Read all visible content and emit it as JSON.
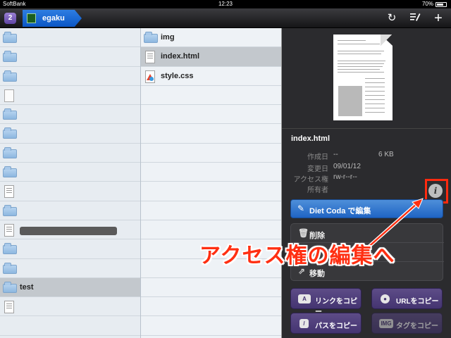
{
  "status_bar": {
    "carrier": "SoftBank",
    "time": "12:23",
    "battery": "70%"
  },
  "toolbar": {
    "tab_count": "2",
    "breadcrumb": "egaku",
    "refresh_icon": "refresh-icon",
    "edit_icon": "edit-list-icon",
    "add_icon": "plus-icon"
  },
  "column1": {
    "rows": [
      {
        "type": "folder",
        "label": ""
      },
      {
        "type": "folder",
        "label": ""
      },
      {
        "type": "folder",
        "label": ""
      },
      {
        "type": "doc",
        "label": ""
      },
      {
        "type": "folder",
        "label": ""
      },
      {
        "type": "folder",
        "label": ""
      },
      {
        "type": "folder",
        "label": ""
      },
      {
        "type": "folder",
        "label": ""
      },
      {
        "type": "html",
        "label": ""
      },
      {
        "type": "folder",
        "label": ""
      },
      {
        "type": "html",
        "label": "",
        "redacted": true
      },
      {
        "type": "folder",
        "label": ""
      },
      {
        "type": "folder",
        "label": ""
      },
      {
        "type": "folder",
        "label": "test",
        "selected": true
      },
      {
        "type": "html",
        "label": ""
      }
    ]
  },
  "column2": {
    "rows": [
      {
        "type": "folder",
        "label": "img"
      },
      {
        "type": "html",
        "label": "index.html",
        "selected": true
      },
      {
        "type": "css",
        "label": "style.css"
      }
    ]
  },
  "info": {
    "filename": "index.html",
    "created_label": "作成日",
    "created_value": "--",
    "size": "6 KB",
    "modified_label": "変更日",
    "modified_value": "09/01/12",
    "permissions_label": "アクセス権",
    "permissions_value": "rw-r--r--",
    "owner_label": "所有者",
    "owner_value": ""
  },
  "actions": {
    "edit_label": "Diet Coda で編集",
    "delete_label": "削除",
    "move_label": "移動",
    "copy_link_label": "リンクをコピー",
    "copy_url_label": "URLをコピー",
    "copy_path_label": "パスをコピー",
    "copy_tag_label": "タグをコピー",
    "copy_link_badge": "A",
    "copy_tag_badge": "IMG"
  },
  "annotation": {
    "text": "アクセス権の編集へ",
    "color": "#ff2f12"
  }
}
